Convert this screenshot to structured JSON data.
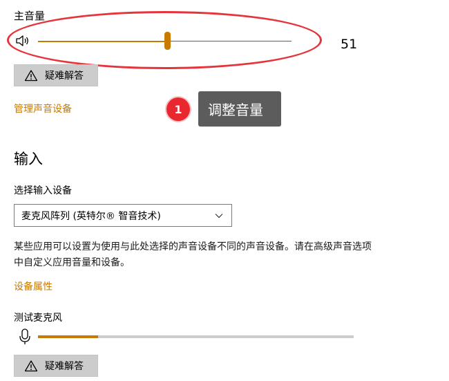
{
  "volume": {
    "label": "主音量",
    "value": 51,
    "value_text": "51",
    "troubleshoot_label": "疑难解答",
    "manage_devices_link": "管理声音设备"
  },
  "annotation": {
    "step_number": "1",
    "tooltip": "调整音量"
  },
  "input": {
    "section_title": "输入",
    "select_label": "选择输入设备",
    "selected_device": "麦克风阵列 (英特尔® 智音技术)",
    "description": "某些应用可以设置为使用与此处选择的声音设备不同的声音设备。请在高级声音选项中自定义应用音量和设备。",
    "device_properties_link": "设备属性",
    "test_mic_label": "测试麦克风",
    "mic_level": 0.19,
    "troubleshoot_label": "疑难解答"
  },
  "colors": {
    "accent": "#c87a00",
    "highlight_ring": "#e6343c",
    "badge": "#e8282e",
    "tooltip_bg": "#5c5c5c"
  },
  "icons": {
    "speaker": "speaker-icon",
    "warning": "warning-icon",
    "chevron": "chevron-down-icon",
    "microphone": "microphone-icon"
  }
}
